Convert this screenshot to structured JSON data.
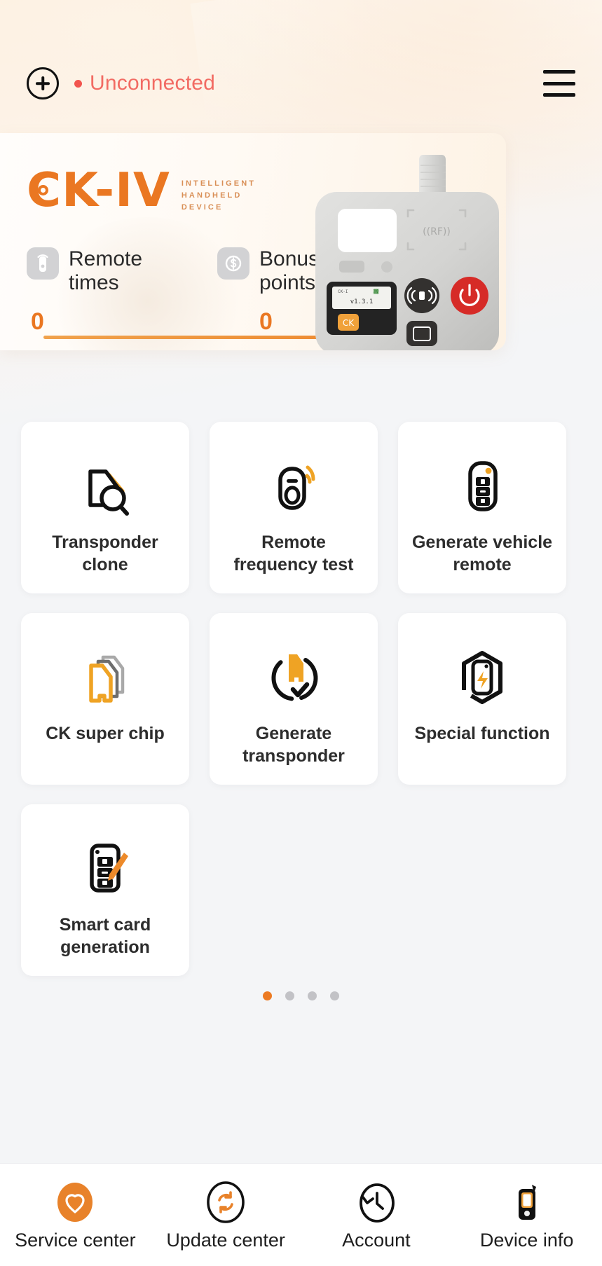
{
  "header": {
    "add_icon": "plus-circle-icon",
    "connection_status": "Unconnected",
    "status_color": "#f26b63",
    "menu_icon": "hamburger-menu-icon"
  },
  "banner": {
    "logo_text": "CK-IV",
    "tagline_line1": "INTELLIGENT",
    "tagline_line2": "HANDHELD",
    "tagline_line3": "DEVICE",
    "accent_color": "#ea7722",
    "stats": [
      {
        "icon": "remote-signal-icon",
        "label": "Remote times",
        "value": "0"
      },
      {
        "icon": "dollar-coin-icon",
        "label": "Bonus points",
        "value": "0"
      }
    ],
    "device": {
      "screen_version": "v1.3.1",
      "rf_label": "((RF))",
      "power_button_color": "#d62b27"
    }
  },
  "grid": {
    "items": [
      {
        "icon": "transponder-clone-icon",
        "label": "Transponder clone"
      },
      {
        "icon": "remote-frequency-icon",
        "label": "Remote frequency test"
      },
      {
        "icon": "vehicle-remote-icon",
        "label": "Generate vehicle remote"
      },
      {
        "icon": "super-chip-icon",
        "label": "CK super chip"
      },
      {
        "icon": "generate-transponder-icon",
        "label": "Generate transponder"
      },
      {
        "icon": "special-function-icon",
        "label": "Special function"
      },
      {
        "icon": "smart-card-icon",
        "label": "Smart card generation"
      }
    ]
  },
  "pagination": {
    "total": 4,
    "active_index": 0,
    "active_color": "#ec7a22",
    "inactive_color": "#c2c2c6"
  },
  "tabbar": {
    "items": [
      {
        "icon": "heart-service-icon",
        "label": "Service center",
        "active": true
      },
      {
        "icon": "refresh-update-icon",
        "label": "Update center",
        "active": false
      },
      {
        "icon": "clock-history-icon",
        "label": "Account",
        "active": false
      },
      {
        "icon": "handheld-device-icon",
        "label": "Device info",
        "active": false
      }
    ]
  }
}
